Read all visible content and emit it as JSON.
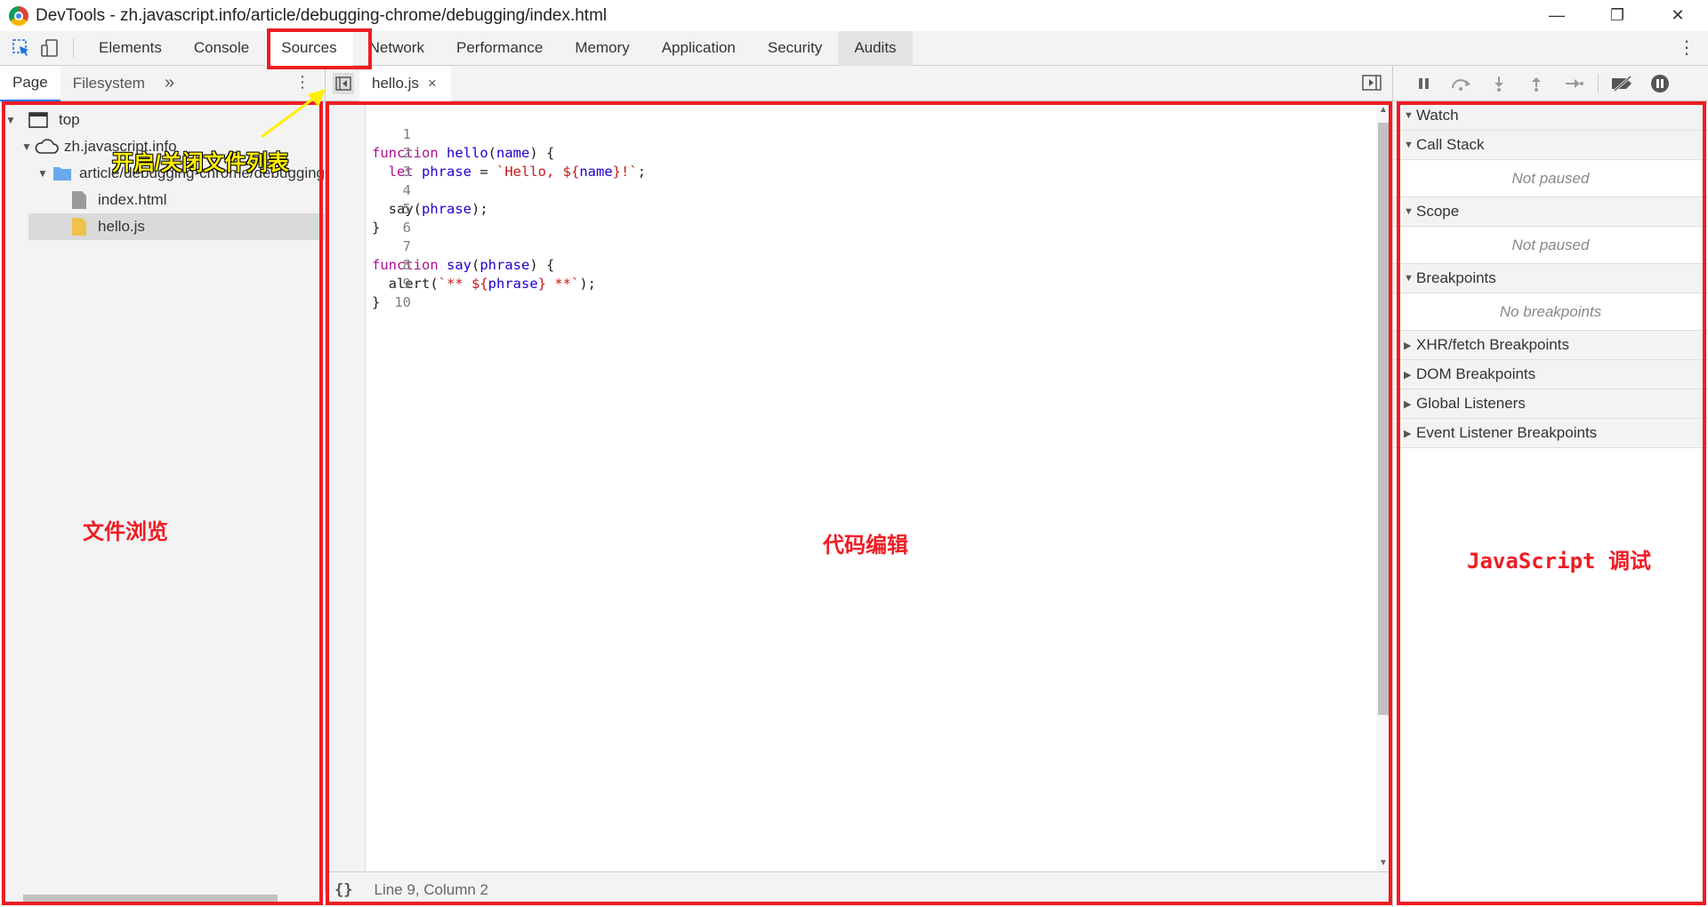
{
  "window": {
    "title": "DevTools - zh.javascript.info/article/debugging-chrome/debugging/index.html",
    "minimize": "—",
    "restore": "❐",
    "close": "✕"
  },
  "toolbar": {
    "tabs": [
      "Elements",
      "Console",
      "Sources",
      "Network",
      "Performance",
      "Memory",
      "Application",
      "Security",
      "Audits"
    ],
    "active_tab": "Sources",
    "more": "⋮"
  },
  "navigator": {
    "tabs": [
      "Page",
      "Filesystem"
    ],
    "more": "»",
    "menu": "⋮",
    "tree": [
      {
        "label": "top",
        "icon": "frame-icon"
      },
      {
        "label": "zh.javascript.info",
        "icon": "cloud-icon"
      },
      {
        "label": "article/debugging-chrome/debugging",
        "icon": "folder-icon"
      },
      {
        "label": "index.html",
        "icon": "html-file-icon"
      },
      {
        "label": "hello.js",
        "icon": "js-file-icon"
      }
    ]
  },
  "editor": {
    "file_tab": "hello.js",
    "close": "×",
    "lines": [
      {
        "n": "1"
      },
      {
        "n": "2"
      },
      {
        "n": "3"
      },
      {
        "n": "4"
      },
      {
        "n": "5"
      },
      {
        "n": "6"
      },
      {
        "n": "7"
      },
      {
        "n": "8"
      },
      {
        "n": "9"
      },
      {
        "n": "10"
      }
    ],
    "code": {
      "l1_kw": "function",
      "l1_fn": "hello",
      "l1_a": "(",
      "l1_arg": "name",
      "l1_b": ") {",
      "l2_kw": "let",
      "l2_var": "phrase",
      "l2_eq": " = ",
      "l2_s1": "`Hello, ",
      "l2_i1": "${",
      "l2_arg": "name",
      "l2_i2": "}",
      "l2_s2": "!`",
      "l2_end": ";",
      "l4_a": "say(",
      "l4_arg": "phrase",
      "l4_b": ");",
      "l5": "}",
      "l7_kw": "function",
      "l7_fn": "say",
      "l7_a": "(",
      "l7_arg": "phrase",
      "l7_b": ") {",
      "l8_a": "alert(",
      "l8_s1": "`** ",
      "l8_i1": "${",
      "l8_arg": "phrase",
      "l8_i2": "}",
      "l8_s2": " **`",
      "l8_b": ");",
      "l9": "}"
    },
    "status_braces": "{}",
    "status": "Line 9, Column 2"
  },
  "debugger": {
    "panes": [
      {
        "title": "Watch",
        "open": true
      },
      {
        "title": "Call Stack",
        "open": true,
        "body": "Not paused"
      },
      {
        "title": "Scope",
        "open": true,
        "body": "Not paused"
      },
      {
        "title": "Breakpoints",
        "open": true,
        "body": "No breakpoints"
      },
      {
        "title": "XHR/fetch Breakpoints",
        "open": false
      },
      {
        "title": "DOM Breakpoints",
        "open": false
      },
      {
        "title": "Global Listeners",
        "open": false
      },
      {
        "title": "Event Listener Breakpoints",
        "open": false
      }
    ]
  },
  "annotations": {
    "toggle_file_list": "开启/关闭文件列表",
    "file_browse": "文件浏览",
    "code_edit": "代码编辑",
    "js_debug": "JavaScript 调试"
  },
  "colors": {
    "annotation_red": "#ee1c24",
    "annotation_yellow": "#ffee00",
    "keyword": "#aa0d91",
    "string": "#c41a16",
    "accent": "#1a73e8"
  }
}
